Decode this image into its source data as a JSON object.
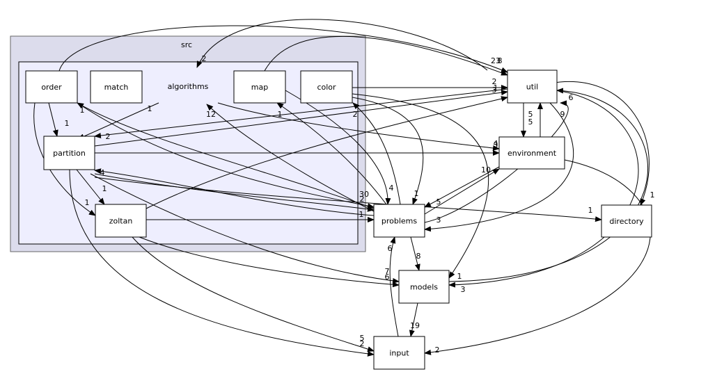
{
  "clusters": {
    "outer": "src",
    "inner": "algorithms"
  },
  "nodes": {
    "order": "order",
    "match": "match",
    "map": "map",
    "color": "color",
    "partition": "partition",
    "zoltan": "zoltan",
    "util": "util",
    "environment": "environment",
    "problems": "problems",
    "directory": "directory",
    "models": "models",
    "input": "input"
  },
  "edges": [
    {
      "from": "order",
      "to": "util",
      "label": "23"
    },
    {
      "from": "map",
      "to": "util",
      "label": "8"
    },
    {
      "from": "util",
      "to": "algorithms",
      "label": "2"
    },
    {
      "from": "color",
      "to": "util",
      "label": "2"
    },
    {
      "from": "partition",
      "to": "util",
      "label": "3"
    },
    {
      "from": "zoltan",
      "to": "util",
      "label": "1"
    },
    {
      "from": "partition",
      "to": "environment",
      "label": "3"
    },
    {
      "from": "algorithms",
      "to": "environment",
      "label": "4"
    },
    {
      "from": "util",
      "to": "environment",
      "label": "5"
    },
    {
      "from": "environment",
      "to": "util",
      "label": "5"
    },
    {
      "from": "environment",
      "to": "problems",
      "label": "5"
    },
    {
      "from": "problems",
      "to": "environment",
      "label": "10"
    },
    {
      "from": "problems",
      "to": "util",
      "label": "9"
    },
    {
      "from": "util",
      "to": "problems",
      "label": "3"
    },
    {
      "from": "problems",
      "to": "order",
      "label": "1"
    },
    {
      "from": "problems",
      "to": "algorithms",
      "label": "12"
    },
    {
      "from": "problems",
      "to": "map",
      "label": "1"
    },
    {
      "from": "problems",
      "to": "color",
      "label": "2"
    },
    {
      "from": "problems",
      "to": "partition",
      "label": "4"
    },
    {
      "from": "map",
      "to": "problems",
      "label": "4"
    },
    {
      "from": "color",
      "to": "problems",
      "label": "1"
    },
    {
      "from": "order",
      "to": "problems",
      "label": "30"
    },
    {
      "from": "partition",
      "to": "problems",
      "label": "2"
    },
    {
      "from": "zoltan",
      "to": "problems",
      "label": "1"
    },
    {
      "from": "problems",
      "to": "models",
      "label": "8"
    },
    {
      "from": "input",
      "to": "problems",
      "label": "6"
    },
    {
      "from": "models",
      "to": "input",
      "label": "19"
    },
    {
      "from": "partition",
      "to": "directory",
      "label": "1"
    },
    {
      "from": "util",
      "to": "directory",
      "label": "1"
    },
    {
      "from": "order",
      "to": "partition",
      "label": "1"
    },
    {
      "from": "order",
      "to": "zoltan",
      "label": "1"
    },
    {
      "from": "partition",
      "to": "zoltan",
      "label": "1"
    },
    {
      "from": "algorithms",
      "to": "partition",
      "label": "1"
    },
    {
      "from": "util",
      "to": "partition",
      "label": "2"
    },
    {
      "from": "zoltan",
      "to": "models",
      "label": "7"
    },
    {
      "from": "partition",
      "to": "models",
      "label": "6"
    },
    {
      "from": "color",
      "to": "models",
      "label": "1"
    },
    {
      "from": "util",
      "to": "models",
      "label": "3"
    },
    {
      "from": "models",
      "to": "util",
      "label": "6"
    },
    {
      "from": "zoltan",
      "to": "input",
      "label": "5"
    },
    {
      "from": "partition",
      "to": "input",
      "label": "2"
    },
    {
      "from": "environment",
      "to": "input",
      "label": "2"
    }
  ]
}
